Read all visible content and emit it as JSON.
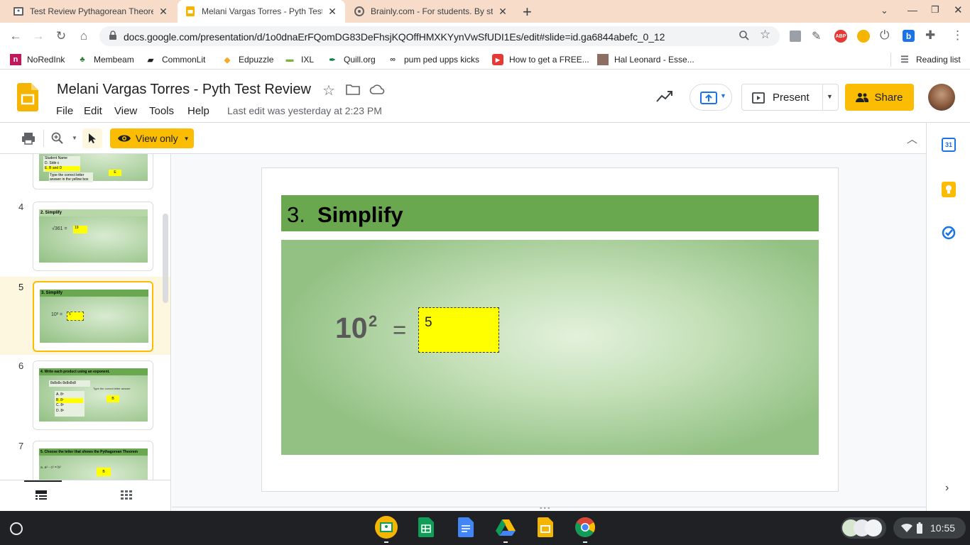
{
  "browser": {
    "tabs": [
      {
        "title": "Test Review Pythagorean Theore",
        "icon": "classroom-icon"
      },
      {
        "title": "Melani Vargas Torres - Pyth Test",
        "icon": "slides-icon"
      },
      {
        "title": "Brainly.com - For students. By st",
        "icon": "brainly-icon"
      }
    ],
    "url": "docs.google.com/presentation/d/1o0dnaErFQomDG83DeFhsjKQOffHMXKYynVwSfUDI1Es/edit#slide=id.ga6844abefc_0_12",
    "bookmarks": [
      "NoRedInk",
      "Membeam",
      "CommonLit",
      "Edpuzzle",
      "IXL",
      "Quill.org",
      "pum ped upps kicks",
      "How to get a FREE...",
      "Hal Leonard - Esse..."
    ],
    "reading_list": "Reading list"
  },
  "doc": {
    "title": "Melani Vargas Torres - Pyth Test Review",
    "menus": [
      "File",
      "Edit",
      "View",
      "Tools",
      "Help"
    ],
    "last_edit": "Last edit was yesterday at 2:23 PM",
    "present_label": "Present",
    "share_label": "Share",
    "view_only_label": "View only"
  },
  "filmstrip": {
    "partial_top": {
      "lines": [
        "Student Name",
        "D.  Side c",
        "E.  B and D",
        "Type the correct letter answer in the yellow box"
      ],
      "answer": "E"
    },
    "slides": [
      {
        "number": "4",
        "title": "2.  Simplify",
        "expr": "√361  =",
        "answer": "19"
      },
      {
        "number": "5",
        "title": "3.  Simplify",
        "expr": "10² =",
        "answer": "5",
        "selected": true
      },
      {
        "number": "6",
        "title": "4.  Write each product using an exponent.",
        "expr": "8x8x8x 8x8x8x8",
        "answer": "B",
        "hint": "Type the correct letter answer",
        "options": [
          "A.    8⁵",
          "B.    8⁷",
          "C.    8⁶",
          "D.    8⁸"
        ]
      },
      {
        "number": "7",
        "title": "5.  Choose the letter that shows the Pythagorean Theorem",
        "expr": "a.    a² - c² = b²",
        "answer": "B"
      }
    ]
  },
  "slide": {
    "number_label": "3.",
    "title": "Simplify",
    "base": "10",
    "exponent": "2",
    "equals": "=",
    "answer": "5"
  },
  "shelf": {
    "time": "10:55"
  },
  "colors": {
    "tabstrip": "#f6dcc9",
    "slide_green": "#6aa84f",
    "answer_yellow": "#ffff00",
    "share_yellow": "#fbbc04"
  }
}
